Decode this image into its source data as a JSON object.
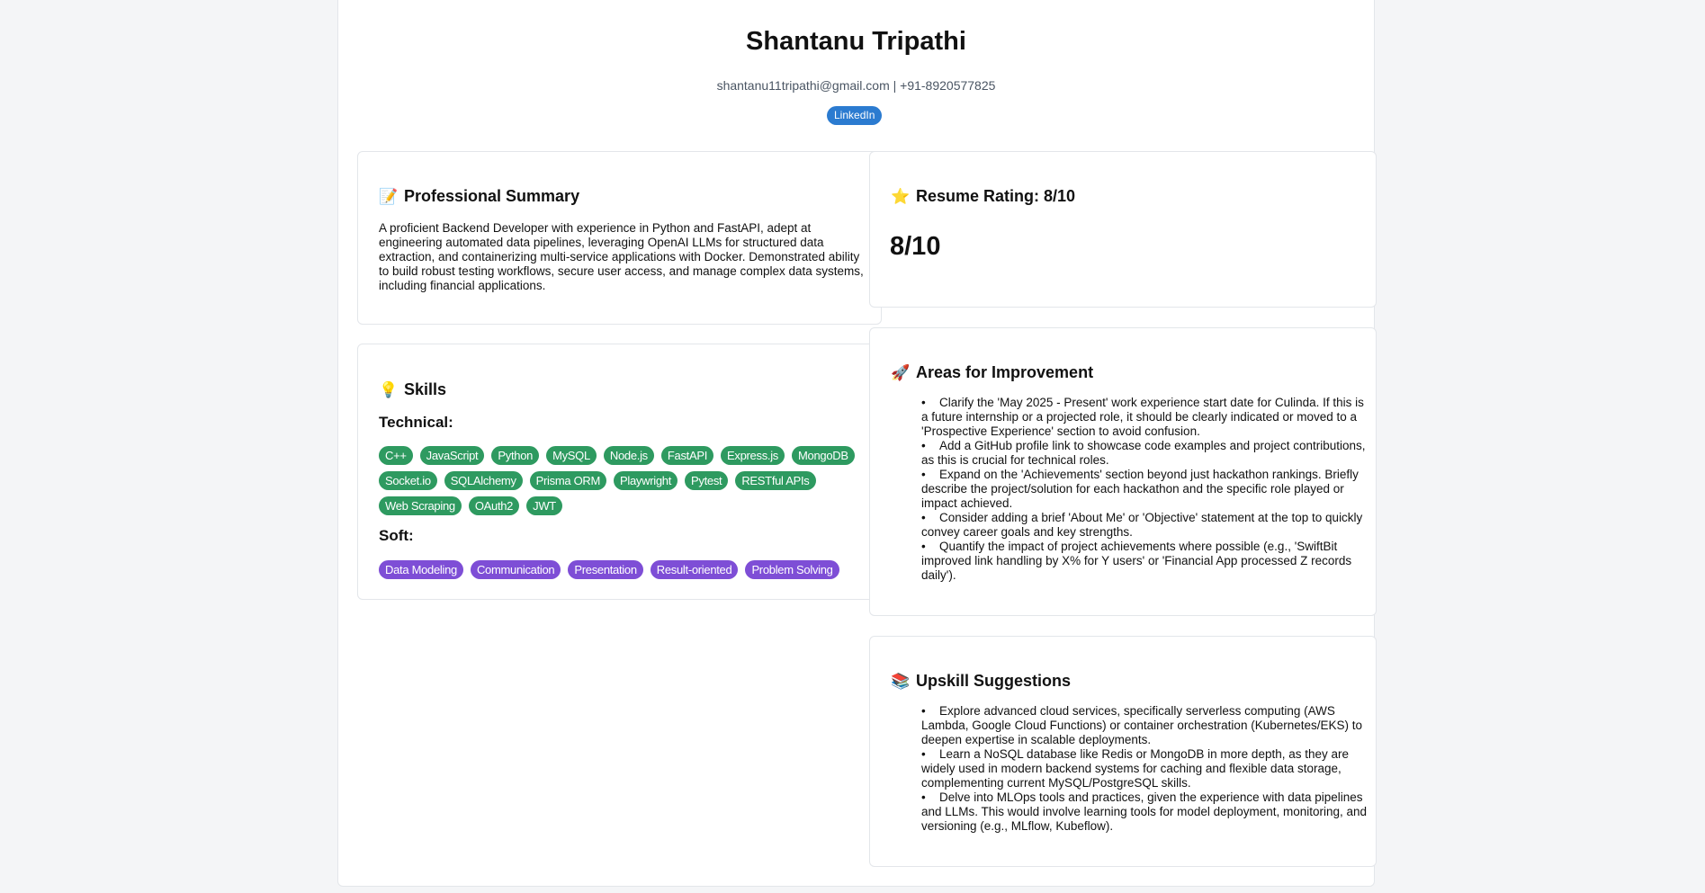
{
  "profile": {
    "name": "Shantanu Tripathi",
    "contact": "shantanu11tripathi@gmail.com | +91-8920577825",
    "linkedin_label": "LinkedIn"
  },
  "summary": {
    "icon": "memo-icon",
    "title": "Professional Summary",
    "text": "A proficient Backend Developer with experience in Python and FastAPI, adept at engineering automated data pipelines, leveraging OpenAI LLMs for structured data extraction, and containerizing multi-service applications with Docker. Demonstrated ability to build robust testing workflows, secure user access, and manage complex data systems, including financial applications."
  },
  "skills": {
    "icon": "lightbulb-icon",
    "title": "Skills",
    "technical_label": "Technical:",
    "technical": [
      "C++",
      "JavaScript",
      "Python",
      "MySQL",
      "Node.js",
      "FastAPI",
      "Express.js",
      "MongoDB",
      "Socket.io",
      "SQLAlchemy",
      "Prisma ORM",
      "Playwright",
      "Pytest",
      "RESTful APIs",
      "Web Scraping",
      "OAuth2",
      "JWT"
    ],
    "soft_label": "Soft:",
    "soft": [
      "Data Modeling",
      "Communication",
      "Presentation",
      "Result-oriented",
      "Problem Solving"
    ]
  },
  "rating": {
    "icon": "star-icon",
    "title": "Resume Rating: 8/10",
    "value": "8/10"
  },
  "improvement": {
    "icon": "rocket-icon",
    "title": "Areas for Improvement",
    "items": [
      "Clarify the 'May 2025 - Present' work experience start date for Culinda. If this is a future internship or a projected role, it should be clearly indicated or moved to a 'Prospective Experience' section to avoid confusion.",
      "Add a GitHub profile link to showcase code examples and project contributions, as this is crucial for technical roles.",
      "Expand on the 'Achievements' section beyond just hackathon rankings. Briefly describe the project/solution for each hackathon and the specific role played or impact achieved.",
      "Consider adding a brief 'About Me' or 'Objective' statement at the top to quickly convey career goals and key strengths.",
      "Quantify the impact of project achievements where possible (e.g., 'SwiftBit improved link handling by X% for Y users' or 'Financial App processed Z records daily')."
    ]
  },
  "upskill": {
    "icon": "books-icon",
    "title": "Upskill Suggestions",
    "items": [
      "Explore advanced cloud services, specifically serverless computing (AWS Lambda, Google Cloud Functions) or container orchestration (Kubernetes/EKS) to deepen expertise in scalable deployments.",
      "Learn a NoSQL database like Redis or MongoDB in more depth, as they are widely used in modern backend systems for caching and flexible data storage, complementing current MySQL/PostgreSQL skills.",
      "Delve into MLOps tools and practices, given the experience with data pipelines and LLMs. This would involve learning tools for model deployment, monitoring, and versioning (e.g., MLflow, Kubeflow)."
    ]
  },
  "colors": {
    "technical_chip": "#2e9a60",
    "soft_chip": "#7e4ed6",
    "linkedin": "#2b7bd0"
  }
}
